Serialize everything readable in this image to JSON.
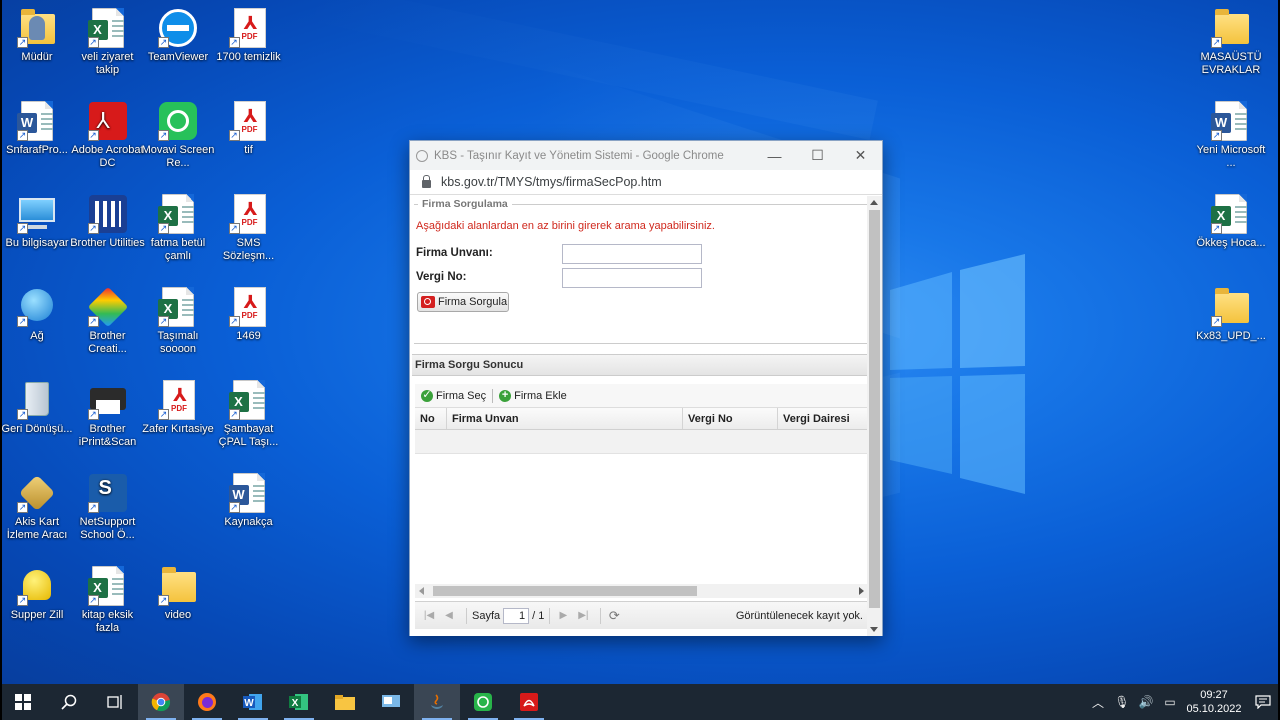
{
  "desktop": {
    "icons_left": [
      {
        "label": "Müdür",
        "icon": "user-folder-icon"
      },
      {
        "label": "veli ziyaret takip",
        "icon": "excel-icon"
      },
      {
        "label": "TeamViewer",
        "icon": "teamviewer-icon"
      },
      {
        "label": "1700 temizlik",
        "icon": "pdf-icon"
      },
      {
        "label": "SnfarafPro...",
        "icon": "word-icon"
      },
      {
        "label": "Adobe Acrobat DC",
        "icon": "acrobat-icon"
      },
      {
        "label": "Movavi Screen Re...",
        "icon": "movavi-icon"
      },
      {
        "label": "tif",
        "icon": "pdf-icon"
      },
      {
        "label": "Bu bilgisayar",
        "icon": "computer-icon"
      },
      {
        "label": "Brother Utilities",
        "icon": "brother-utilities-icon"
      },
      {
        "label": "fatma betül çamlı",
        "icon": "excel-icon"
      },
      {
        "label": "SMS Sözleşm...",
        "icon": "pdf-icon"
      },
      {
        "label": "Ağ",
        "icon": "network-icon"
      },
      {
        "label": "Brother Creati...",
        "icon": "brother-creative-icon"
      },
      {
        "label": "Taşımalı soooon",
        "icon": "excel-icon"
      },
      {
        "label": "1469",
        "icon": "pdf-icon"
      },
      {
        "label": "Geri Dönüşü...",
        "icon": "recycle-bin-icon"
      },
      {
        "label": "Brother iPrint&Scan",
        "icon": "printer-icon"
      },
      {
        "label": "Zafer Kırtasiye",
        "icon": "pdf-icon"
      },
      {
        "label": "Şambayat ÇPAL Taşı...",
        "icon": "excel-icon"
      },
      {
        "label": "Akis Kart İzleme Aracı",
        "icon": "smartcard-icon"
      },
      {
        "label": "NetSupport School Ö...",
        "icon": "netsupport-icon"
      },
      {
        "label": "Kaynakça",
        "icon": "word-icon"
      },
      {
        "label": "Supper Zill",
        "icon": "bell-icon"
      },
      {
        "label": "kitap eksik fazla",
        "icon": "excel-icon"
      },
      {
        "label": "video",
        "icon": "folder-icon"
      }
    ],
    "icons_right": [
      {
        "label": "MASAÜSTÜ EVRAKLAR",
        "icon": "folder-icon"
      },
      {
        "label": "Yeni Microsoft ...",
        "icon": "word-icon"
      },
      {
        "label": "Ökkeş Hoca...",
        "icon": "excel-icon"
      },
      {
        "label": "Kx83_UPD_...",
        "icon": "folder-icon"
      }
    ],
    "pdf_text": "PDF",
    "excel_letter": "X",
    "word_letter": "W"
  },
  "browser": {
    "title": "KBS - Taşınır Kayıt ve Yönetim Sistemi - Google Chrome",
    "url": "kbs.gov.tr/TMYS/tmys/firmaSecPop.htm",
    "minimize": "—",
    "maximize": "☐",
    "close": "✕"
  },
  "form": {
    "legend": "Firma Sorgulama",
    "warning": "Aşağıdaki alanlardan en az birini girerek arama yapabilirsiniz.",
    "firma_unvani_label": "Firma Unvanı:",
    "firma_unvani_value": "",
    "vergi_no_label": "Vergi No:",
    "vergi_no_value": "",
    "sorgula_button": "Firma Sorgula"
  },
  "results": {
    "title": "Firma Sorgu Sonucu",
    "toolbar": {
      "select": "Firma Seç",
      "add": "Firma Ekle"
    },
    "columns": [
      "No",
      "Firma Unvan",
      "Vergi No",
      "Vergi Dairesi"
    ],
    "pager": {
      "page_label": "Sayfa",
      "page_value": "1",
      "page_total": "/ 1",
      "info": "Görüntülenecek kayıt yok."
    }
  },
  "taskbar": {
    "apps": [
      "start-icon",
      "search-icon",
      "task-view-icon",
      "chrome-icon",
      "firefox-icon",
      "word-icon",
      "excel-icon",
      "file-explorer-icon",
      "control-panel-icon",
      "java-icon",
      "movavi-icon",
      "acrobat-icon"
    ],
    "time": "09:27",
    "date": "05.10.2022"
  }
}
